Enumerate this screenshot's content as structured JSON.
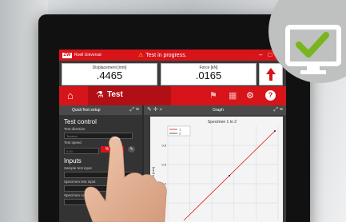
{
  "app": {
    "logo": "ZW",
    "name": "Roell Universal"
  },
  "status": {
    "text": "Test in progress."
  },
  "window_controls": [
    "–",
    "□",
    "✕"
  ],
  "readouts": [
    {
      "label": "Displacement [mm]",
      "value": ".4465"
    },
    {
      "label": "Force [kN]",
      "value": ".0165"
    }
  ],
  "toolbar": {
    "tab_label": "Test",
    "help": "?"
  },
  "left_panel": {
    "title": "QuickTest setup",
    "section1": "Test control",
    "test_direction_label": "Test direction",
    "test_direction_value": "Tension",
    "test_speed_label": "Test speed",
    "test_speed_value": "5.00",
    "test_speed_unit": "%",
    "section2": "Inputs",
    "sample_label": "Sample test input",
    "specimen_label": "Specimen test input",
    "specimen_note": "Specimen note"
  },
  "right_panel": {
    "title": "Graph",
    "graph_title": "Specimen 1 to 2",
    "ylabel": "Displacement [mm]",
    "legend": [
      "1",
      "2"
    ]
  },
  "chart_data": {
    "type": "line",
    "title": "Specimen 1 to 2",
    "ylabel": "Displacement [mm]",
    "yticks": [
      "0.8",
      "0.6",
      "0.4",
      "0.2"
    ],
    "series": [
      {
        "name": "1",
        "x": [
          0,
          0.5,
          1.0
        ],
        "y": [
          0,
          0.5,
          1.0
        ]
      }
    ]
  },
  "colors": {
    "brand_red": "#d7141a",
    "panel_dark": "#333333",
    "check_green": "#7ab51d"
  },
  "icons": [
    "home-icon",
    "test-icon",
    "finish-flag-icon",
    "save-icon",
    "settings-icon",
    "help-icon",
    "monitor-check-icon"
  ]
}
